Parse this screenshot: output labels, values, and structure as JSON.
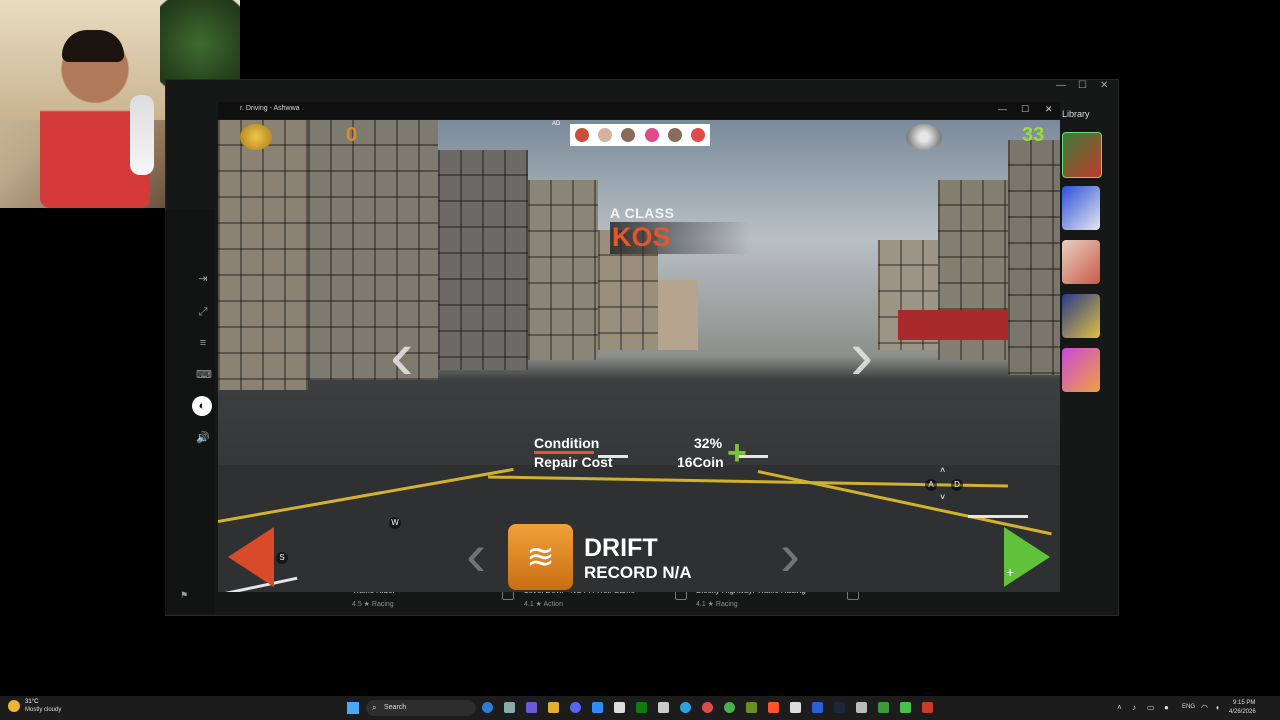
{
  "launcher": {
    "library_label": "Library",
    "store_items": [
      {
        "name": "Traffic Rider",
        "meta": "4.5 ★ Racing"
      },
      {
        "name": "Level Devil - NOT A Troll Game",
        "meta": "4.1 ★ Action"
      },
      {
        "name": "Blocky Highway: Traffic Racing",
        "meta": "4.1 ★ Racing"
      }
    ],
    "window_controls": {
      "minimize": "—",
      "maximize": "☐",
      "close": "✕"
    }
  },
  "game_window": {
    "title": "r. Driving - Ashwwa",
    "controls": {
      "minimize": "—",
      "maximize": "☐",
      "close": "✕"
    }
  },
  "hud": {
    "coins": "0",
    "counter": "33",
    "ad_label": "AD"
  },
  "car": {
    "class": "A CLASS",
    "name": "KOS",
    "condition_label": "Condition",
    "condition_value": "32%",
    "repair_label": "Repair Cost",
    "repair_value": "16Coin",
    "repair_button": "+"
  },
  "mode": {
    "name": "DRIFT",
    "record": "RECORD N/A"
  },
  "keys": {
    "w": "W",
    "s": "S",
    "a": "A",
    "d": "D"
  },
  "taskbar": {
    "weather_temp": "31°C",
    "weather_desc": "Mostly cloudy",
    "search": "Search",
    "lang": "ENG",
    "time": "9:15 PM",
    "date": "4/26/2026"
  },
  "colors": {
    "accent_orange": "#e4572e",
    "accent_green": "#5fc23a",
    "mode_orange": "#f1a13a"
  }
}
